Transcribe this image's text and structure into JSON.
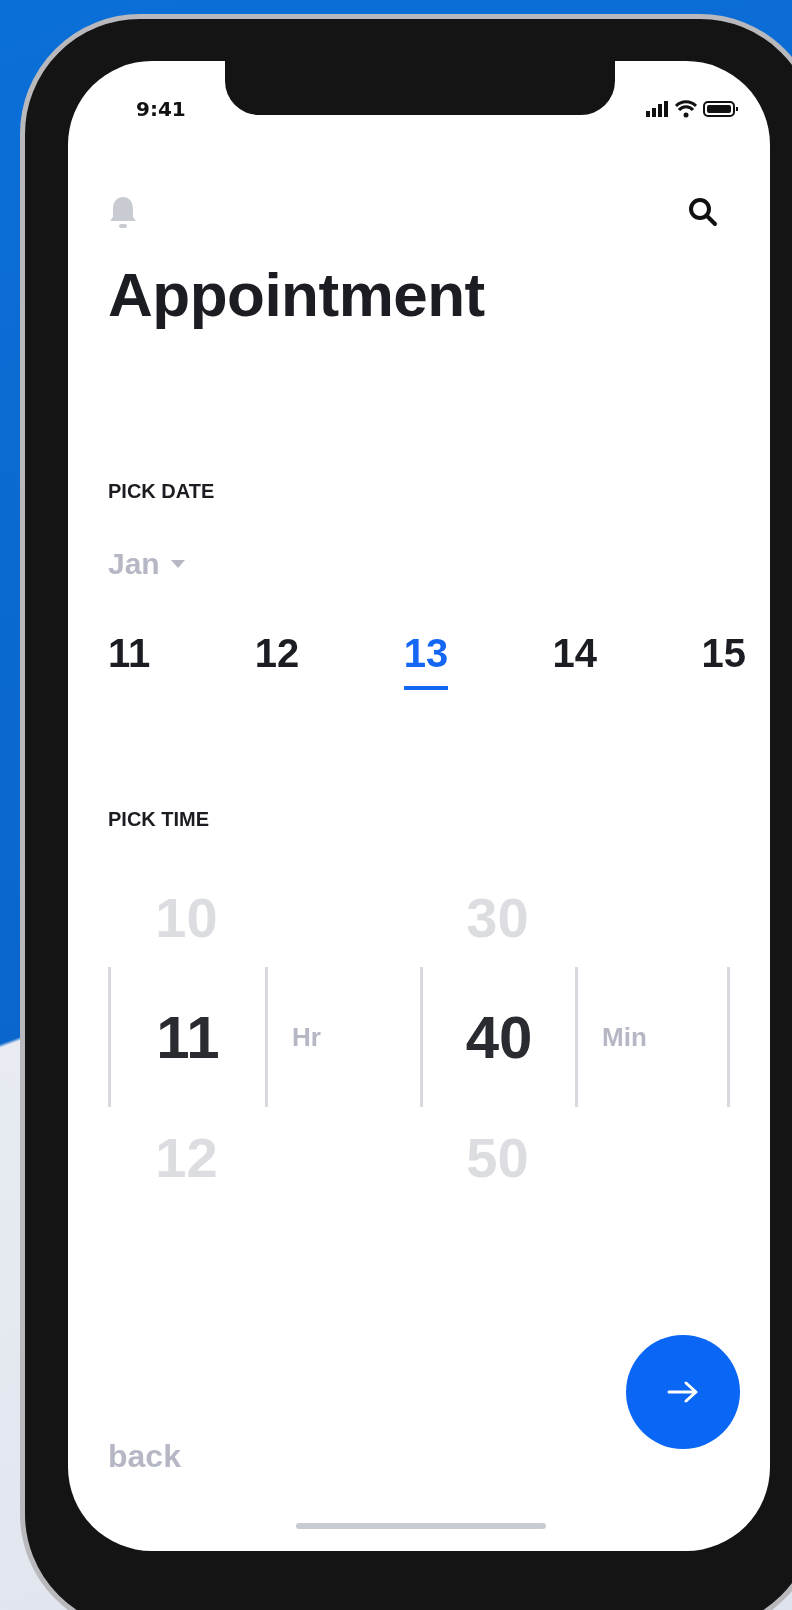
{
  "status_bar": {
    "time": "9:41"
  },
  "title": "Appointment",
  "date_section": {
    "label": "PICK DATE",
    "month": "Jan",
    "days": [
      {
        "label": "11",
        "selected": false
      },
      {
        "label": "12",
        "selected": false
      },
      {
        "label": "13",
        "selected": true
      },
      {
        "label": "14",
        "selected": false
      },
      {
        "label": "15",
        "selected": false
      }
    ]
  },
  "time_section": {
    "label": "PICK TIME",
    "hours": [
      {
        "label": "10",
        "selected": false
      },
      {
        "label": "11",
        "selected": true
      },
      {
        "label": "12",
        "selected": false
      }
    ],
    "hour_unit": "Hr",
    "minutes": [
      {
        "label": "30",
        "selected": false
      },
      {
        "label": "40",
        "selected": true
      },
      {
        "label": "50",
        "selected": false
      }
    ],
    "minute_unit": "Min"
  },
  "back": "back"
}
